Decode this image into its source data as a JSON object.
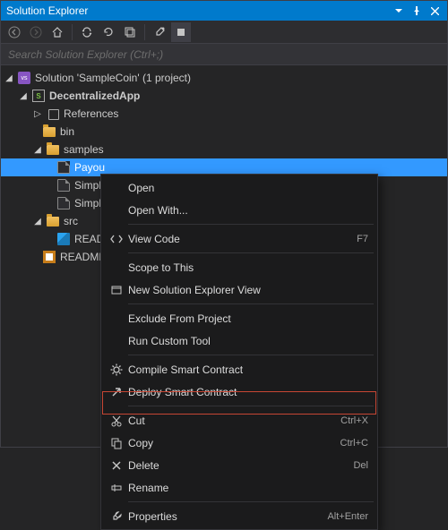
{
  "panel_title": "Solution Explorer",
  "search": {
    "placeholder": "Search Solution Explorer (Ctrl+;)"
  },
  "tree": {
    "solution_label": "Solution 'SampleCoin' (1 project)",
    "project_label": "DecentralizedApp",
    "references_label": "References",
    "bin_label": "bin",
    "samples_label": "samples",
    "samples_items": [
      "Payou",
      "Simpl",
      "Simpl"
    ],
    "src_label": "src",
    "src_items": [
      "READM"
    ],
    "readme_label": "README."
  },
  "context_menu": {
    "open": "Open",
    "open_with": "Open With...",
    "view_code": "View Code",
    "view_code_key": "F7",
    "scope_to_this": "Scope to This",
    "new_view": "New Solution Explorer View",
    "exclude": "Exclude From Project",
    "run_tool": "Run Custom Tool",
    "compile": "Compile Smart Contract",
    "deploy": "Deploy Smart Contract",
    "cut": "Cut",
    "cut_key": "Ctrl+X",
    "copy": "Copy",
    "copy_key": "Ctrl+C",
    "delete": "Delete",
    "delete_key": "Del",
    "rename": "Rename",
    "properties": "Properties",
    "properties_key": "Alt+Enter"
  },
  "colors": {
    "accent": "#007acc",
    "selection": "#3399ff",
    "highlight_border": "#c74634"
  }
}
